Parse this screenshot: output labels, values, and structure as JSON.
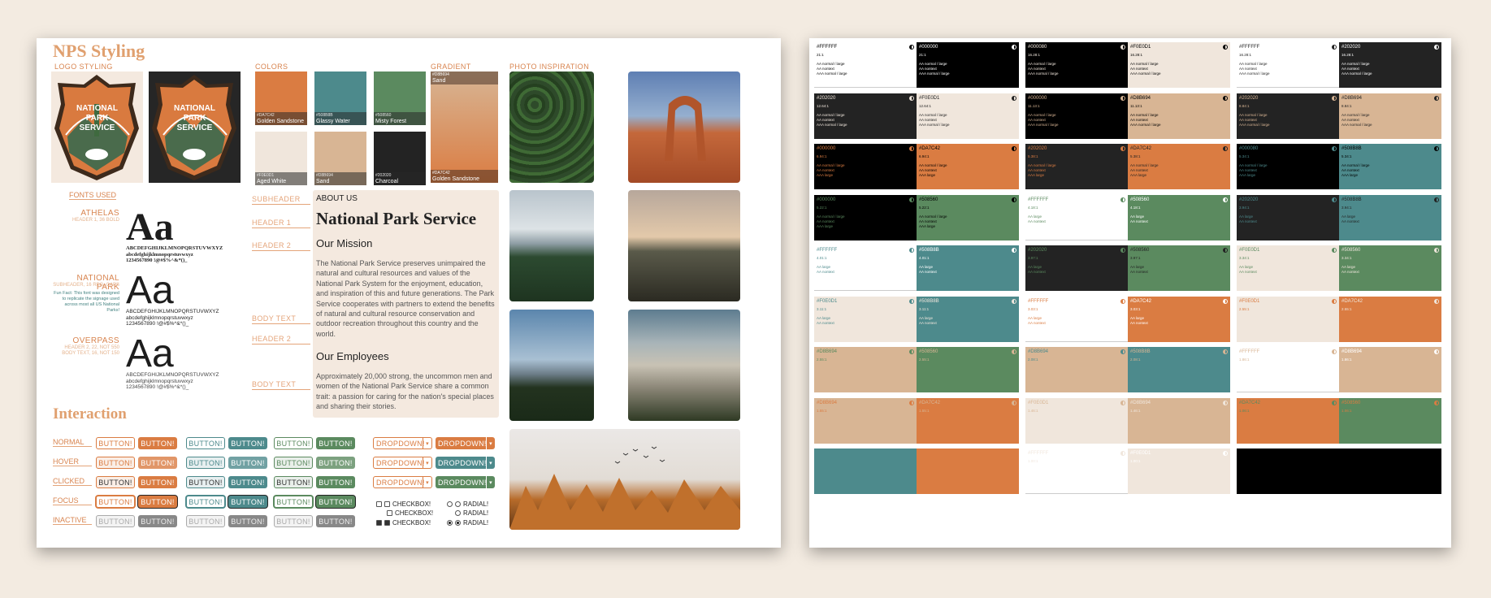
{
  "left": {
    "title": "NPS Styling",
    "logo_label": "LOGO STYLING",
    "logo_text": [
      "NATIONAL",
      "PARK",
      "SERVICE"
    ],
    "colors_label": "COLORS",
    "gradient_label": "GRADIENT",
    "photo_label": "PHOTO INSPIRATION",
    "swatches": [
      {
        "hex": "#DA7C42",
        "name": "Golden Sandstone",
        "color": "#da7c42",
        "light": false
      },
      {
        "hex": "#508B8B",
        "name": "Glassy Water",
        "color": "#4d8a8c",
        "light": false
      },
      {
        "hex": "#508560",
        "name": "Misty Forest",
        "color": "#5b8a5f",
        "light": false
      },
      {
        "hex": "#F0E0D1",
        "name": "Aged White",
        "color": "#f0e6dc",
        "light": true
      },
      {
        "hex": "#D8B694",
        "name": "Sand",
        "color": "#d8b594",
        "light": false
      },
      {
        "hex": "#202020",
        "name": "Charcoal",
        "color": "#232323",
        "light": false
      }
    ],
    "gradient_top": {
      "hex": "#D8B694",
      "name": "Sand"
    },
    "gradient_bottom": {
      "hex": "#DA7C42",
      "name": "Golden Sandstone"
    },
    "fonts_used": "FONTS USED",
    "fonts": [
      {
        "name": "ATHELAS",
        "sub": "HEADER 1, 36 BOLD",
        "aa": "Aa",
        "upper": "ABCDEFGHIJKLMNOPQRSTUVWXYZ",
        "lower": "abcdefghijklmnopqrstuvwxyz",
        "digits": "1234567890 !@#$%^&*()_"
      },
      {
        "name": "NATIONAL PARK",
        "sub": "SUBHEADER, 16 REG, CAPS",
        "fun": "Fun Fact: This font was designed to replicate the signage used across most all US National Parks!",
        "aa": "Aa",
        "upper": "ABCDEFGHIJKLMNOPQRSTUVWXYZ",
        "lower": "abcdefghijklmnopqrstuvwxyz",
        "digits": "1234567890 !@#$%^&*()_"
      },
      {
        "name": "OVERPASS",
        "sub": "HEADER 2, 22, NOT 550 BODY TEXT, 16, NOT 150",
        "aa": "Aa",
        "upper": "ABCDEFGHIJKLMNOPQRSTUVWXYZ",
        "lower": "abcdefghijklmnopqrstuvwxyz",
        "digits": "1234567890 !@#$%^&*()_"
      }
    ],
    "type_labels": {
      "subheader": "SUBHEADER",
      "header1": "HEADER 1",
      "header2": "HEADER 2",
      "body1": "BODY TEXT",
      "header2b": "HEADER 2",
      "body2": "BODY TEXT"
    },
    "sample": {
      "subheader": "ABOUT US",
      "header1": "National Park Service",
      "header2a": "Our Mission",
      "body1": "The National Park Service preserves unimpaired the natural and cultural resources and values of the National Park System for the enjoyment, education, and inspiration of this and future generations. The Park Service cooperates with partners to extend the benefits of natural and cultural resource conservation and outdoor recreation throughout this country and the world.",
      "header2b": "Our Employees",
      "body2": "Approximately 20,000 strong, the uncommon men and women of the National Park Service share a common trait: a passion for caring for the nation's special places and sharing their stories."
    },
    "interaction_title": "Interaction",
    "states": [
      "NORMAL",
      "HOVER",
      "CLICKED",
      "FOCUS",
      "INACTIVE"
    ],
    "button_label": "BUTTON!",
    "dropdown_label": "DROPDOWN!",
    "checkbox_label": "CHECKBOX!",
    "radial_label": "RADIAL!"
  },
  "palette": {
    "cells": [
      [
        "#FFFFFF",
        "21:1",
        "#000000",
        "21:1",
        "#000080",
        "16.28:1",
        "#F0E0D1",
        "16.28:1",
        "#FFFFFF",
        "16.28:1",
        "#202020",
        "16.28:1"
      ],
      [
        "#202020",
        "12.64:1",
        "#F0E0D1",
        "12.64:1",
        "#000000",
        "11.13:1",
        "#D8B694",
        "11.13:1",
        "#202020",
        "8.84:1",
        "#D8B694",
        "8.84:1"
      ],
      [
        "#000000",
        "6.94:1",
        "#DA7C42",
        "6.94:1",
        "#202020",
        "5.38:1",
        "#DA7C42",
        "5.38:1",
        "#000080",
        "5.34:1",
        "#508B8B",
        "5.34:1"
      ],
      [
        "#000000",
        "5.22:1",
        "#508560",
        "5.22:1",
        "#FFFFFF",
        "4.18:1",
        "#508560",
        "4.18:1",
        "#202020",
        "3.94:1",
        "#508B8B",
        "3.94:1"
      ],
      [
        "#FFFFFF",
        "4.01:1",
        "#508B8B",
        "4.01:1",
        "#202020",
        "3.97:1",
        "#508560",
        "3.97:1",
        "#F0E0D1",
        "3.34:1",
        "#508560",
        "3.34:1"
      ],
      [
        "#F0E0D1",
        "3.11:1",
        "#508B8B",
        "3.11:1",
        "#FFFFFF",
        "3.03:1",
        "#DA7C42",
        "3.03:1",
        "#F0E0D1",
        "2.55:1",
        "#DA7C42",
        "2.55:1"
      ],
      [
        "#D8B694",
        "2.55:1",
        "#508560",
        "2.55:1",
        "#D8B694",
        "2.08:1",
        "#508B8B",
        "2.08:1",
        "#FFFFFF",
        "1.86:1",
        "#D8B694",
        "1.86:1"
      ],
      [
        "#D8B694",
        "1.55:1",
        "#DA7C42",
        "1.55:1",
        "#F0E0D1",
        "1.46:1",
        "#D8B694",
        "1.46:1",
        "#DA7C42",
        "1.06:1",
        "#508560",
        "1.06:1"
      ],
      [
        "#508B8B",
        "1.00:1",
        "#DA7C42",
        "1.00:1",
        "#FFFFFF",
        "1.00:1",
        "#F0E0D1",
        "1.00:1",
        "#000000",
        "1.00:1",
        "#000000",
        "1.00:1"
      ]
    ],
    "checks_text": {
      "aaa": [
        "AA normal / large",
        "AA nontext",
        "AAA normal / large"
      ],
      "aa": [
        "AA normal / large",
        "AA nontext",
        "AAA large"
      ],
      "aa_only": [
        "AA large",
        "AA nontext"
      ]
    }
  }
}
